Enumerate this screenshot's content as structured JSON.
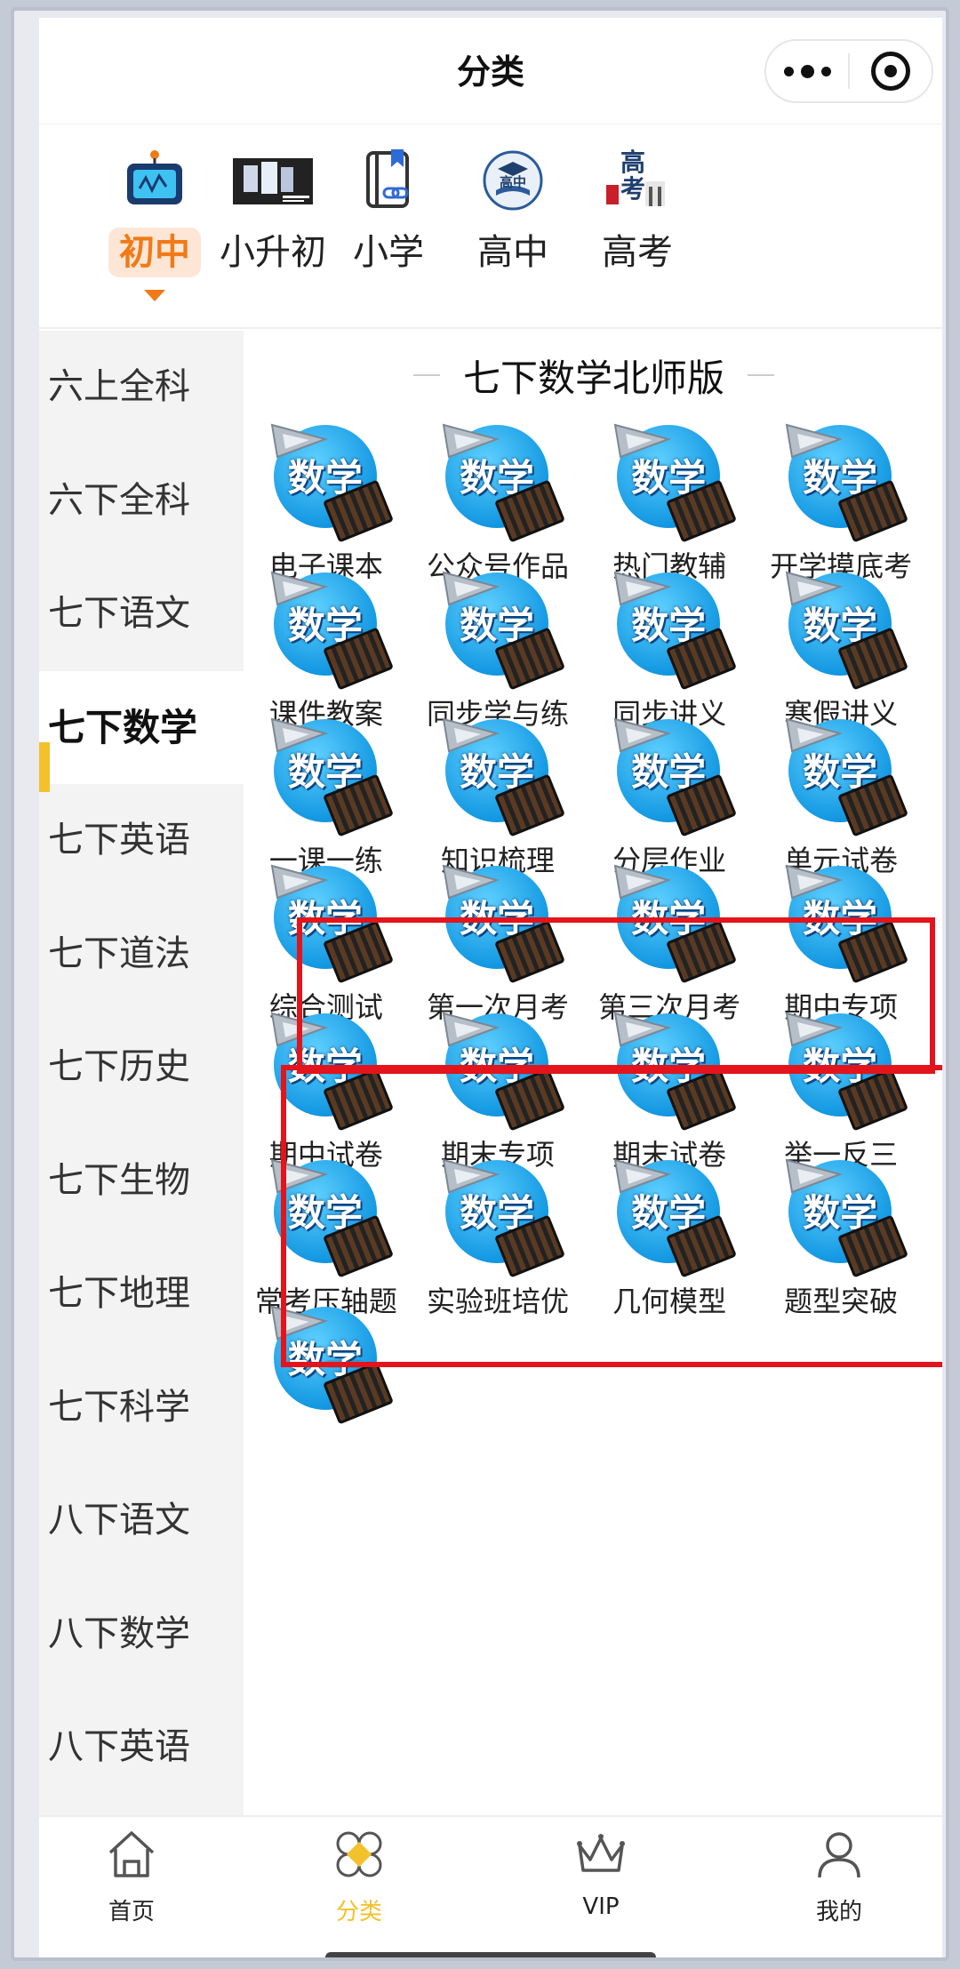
{
  "header": {
    "title": "分类"
  },
  "grade_tabs": [
    {
      "label": "初中",
      "icon": "tv-screen-icon",
      "active": true
    },
    {
      "label": "小升初",
      "icon": "banner-thumbnail-icon",
      "active": false
    },
    {
      "label": "小学",
      "icon": "book-link-icon",
      "active": false
    },
    {
      "label": "高中",
      "icon": "high-school-badge-icon",
      "badge_text": "高中",
      "active": false
    },
    {
      "label": "高考",
      "icon": "gaokao-gate-icon",
      "badge_text": "高考",
      "active": false
    }
  ],
  "sidebar": {
    "items": [
      {
        "label": "六上全科"
      },
      {
        "label": "六下全科"
      },
      {
        "label": "七下语文"
      },
      {
        "label": "七下数学",
        "active": true
      },
      {
        "label": "七下英语"
      },
      {
        "label": "七下道法"
      },
      {
        "label": "七下历史"
      },
      {
        "label": "七下生物"
      },
      {
        "label": "七下地理"
      },
      {
        "label": "七下科学"
      },
      {
        "label": "八下语文"
      },
      {
        "label": "八下数学"
      },
      {
        "label": "八下英语"
      }
    ]
  },
  "content": {
    "section_title": "七下数学北师版",
    "icon_text": "数学",
    "items": [
      {
        "label": "电子课本"
      },
      {
        "label": "公众号作品"
      },
      {
        "label": "热门教辅"
      },
      {
        "label": "开学摸底考"
      },
      {
        "label": "课件教案"
      },
      {
        "label": "同步学与练"
      },
      {
        "label": "同步讲义"
      },
      {
        "label": "寒假讲义"
      },
      {
        "label": "一课一练"
      },
      {
        "label": "知识梳理"
      },
      {
        "label": "分层作业"
      },
      {
        "label": "单元试卷"
      },
      {
        "label": "综合测试"
      },
      {
        "label": "第一次月考"
      },
      {
        "label": "第三次月考"
      },
      {
        "label": "期中专项"
      },
      {
        "label": "期中试卷"
      },
      {
        "label": "期末专项"
      },
      {
        "label": "期末试卷"
      },
      {
        "label": "举一反三"
      },
      {
        "label": "常考压轴题"
      },
      {
        "label": "实验班培优"
      },
      {
        "label": "几何模型"
      },
      {
        "label": "题型突破"
      },
      {
        "label": ""
      }
    ]
  },
  "tabbar": {
    "items": [
      {
        "label": "首页",
        "icon": "home-icon"
      },
      {
        "label": "分类",
        "icon": "category-icon",
        "active": true
      },
      {
        "label": "VIP",
        "icon": "crown-icon"
      },
      {
        "label": "我的",
        "icon": "user-icon"
      }
    ]
  },
  "colors": {
    "accent_orange": "#f07a18",
    "active_yellow": "#f3c12b",
    "highlight_red": "#e3141b",
    "math_blue": "#1398e2"
  }
}
